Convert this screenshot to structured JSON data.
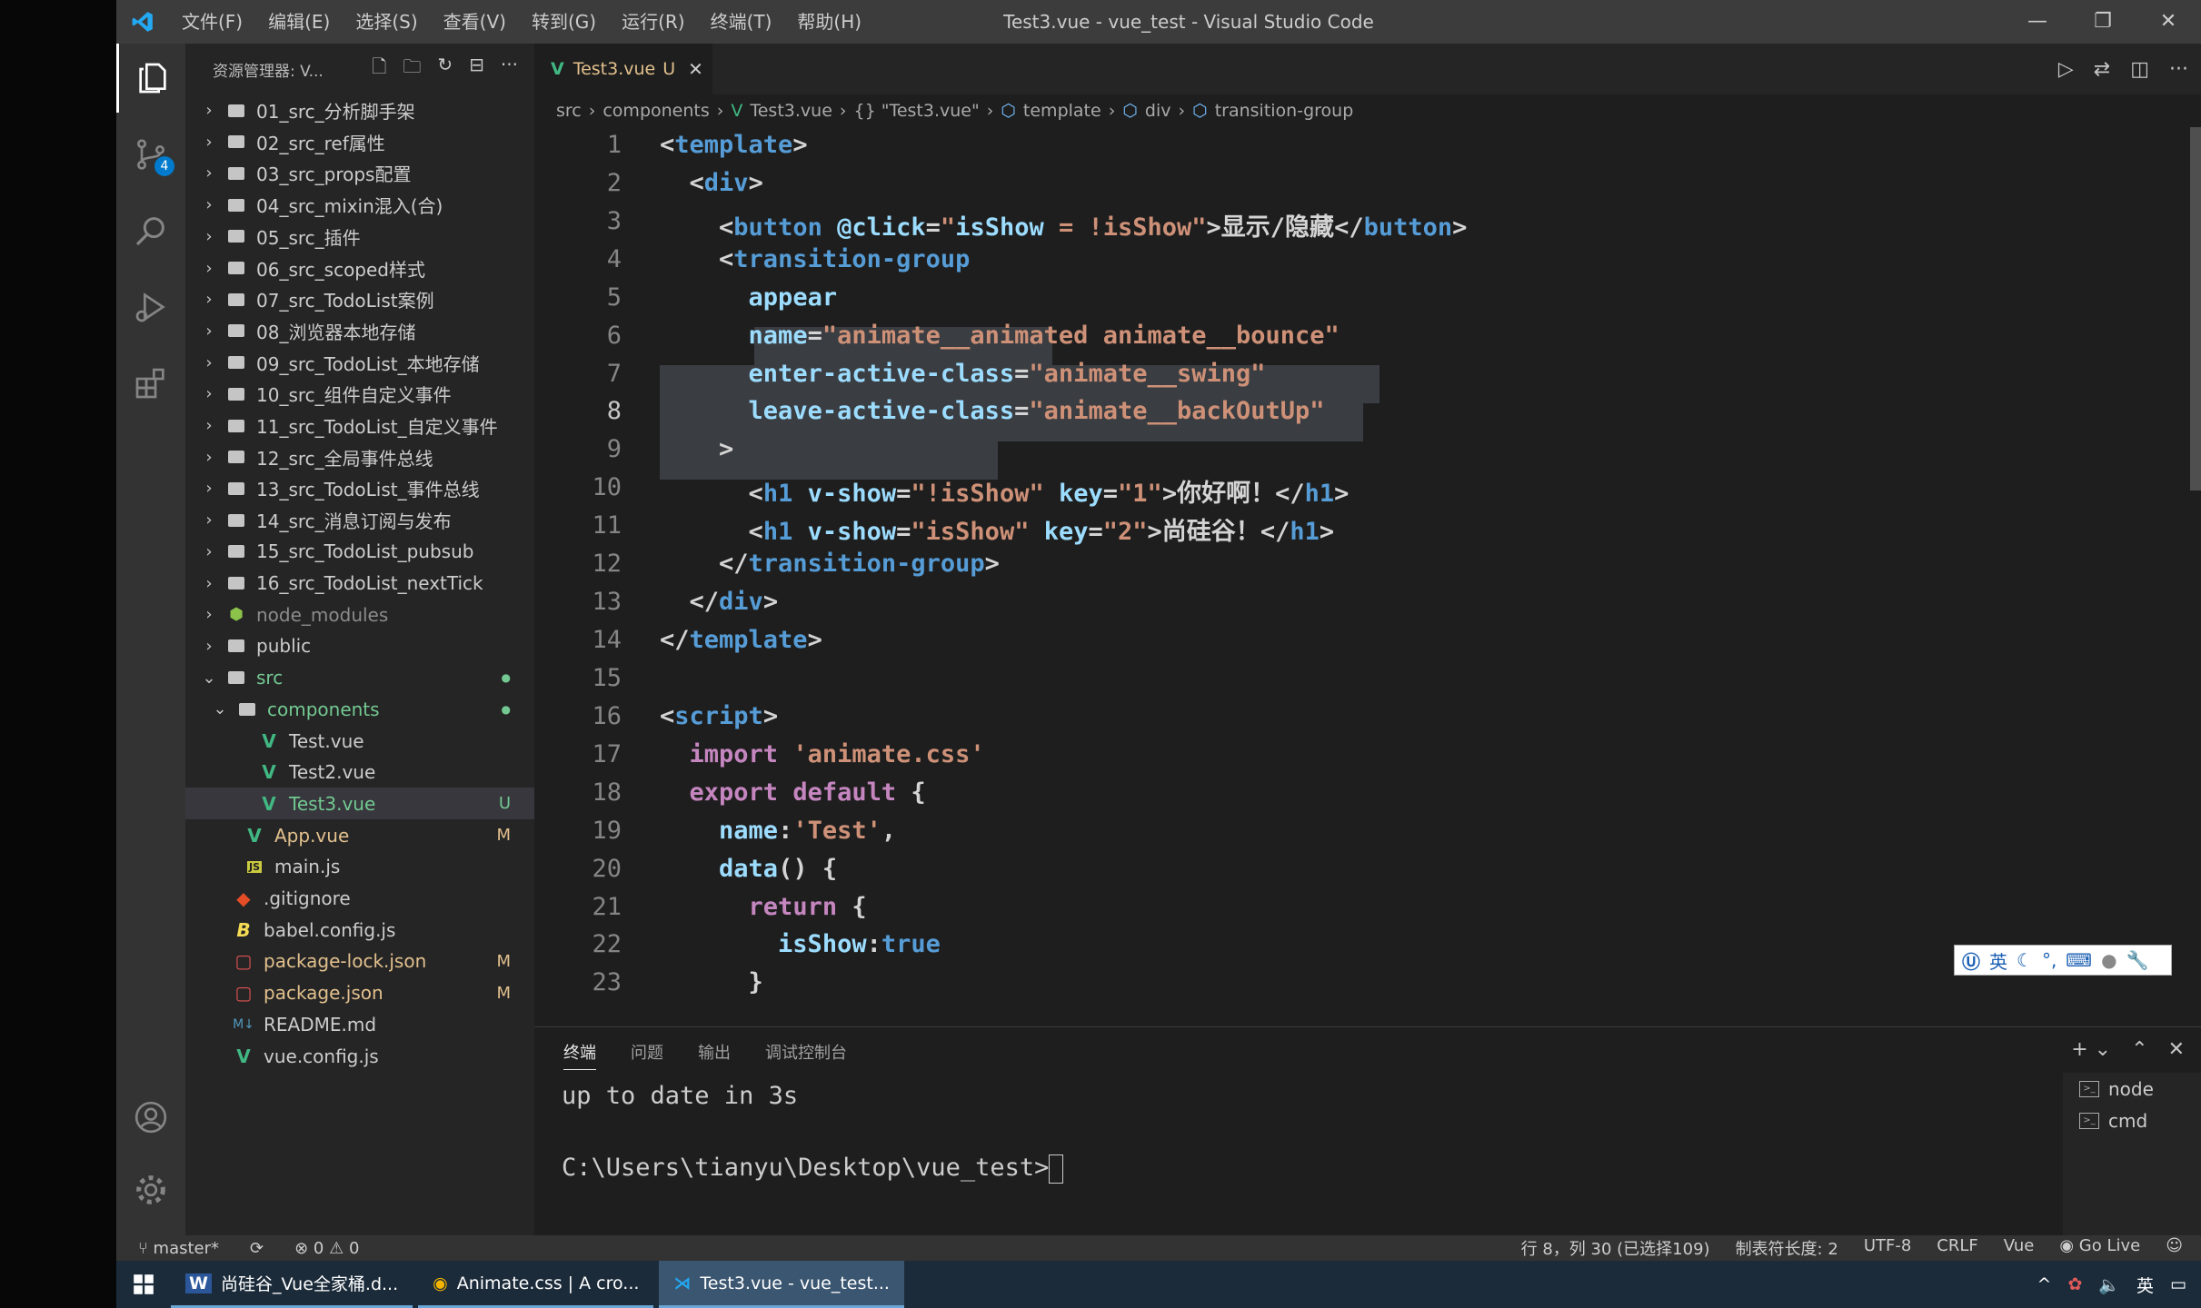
{
  "window": {
    "title": "Test3.vue - vue_test - Visual Studio Code",
    "menu": [
      "文件(F)",
      "编辑(E)",
      "选择(S)",
      "查看(V)",
      "转到(G)",
      "运行(R)",
      "终端(T)",
      "帮助(H)"
    ],
    "controls": {
      "minimize": "—",
      "restore": "❐",
      "close": "✕"
    }
  },
  "activity": {
    "scm_badge": "4"
  },
  "sidebar": {
    "title": "资源管理器: V...",
    "items": [
      {
        "label": "01_src_分析脚手架",
        "kind": "folder"
      },
      {
        "label": "02_src_ref属性",
        "kind": "folder"
      },
      {
        "label": "03_src_props配置",
        "kind": "folder"
      },
      {
        "label": "04_src_mixin混入(合)",
        "kind": "folder"
      },
      {
        "label": "05_src_插件",
        "kind": "folder"
      },
      {
        "label": "06_src_scoped样式",
        "kind": "folder"
      },
      {
        "label": "07_src_TodoList案例",
        "kind": "folder"
      },
      {
        "label": "08_浏览器本地存储",
        "kind": "folder"
      },
      {
        "label": "09_src_TodoList_本地存储",
        "kind": "folder"
      },
      {
        "label": "10_src_组件自定义事件",
        "kind": "folder"
      },
      {
        "label": "11_src_TodoList_自定义事件",
        "kind": "folder"
      },
      {
        "label": "12_src_全局事件总线",
        "kind": "folder"
      },
      {
        "label": "13_src_TodoList_事件总线",
        "kind": "folder"
      },
      {
        "label": "14_src_消息订阅与发布",
        "kind": "folder"
      },
      {
        "label": "15_src_TodoList_pubsub",
        "kind": "folder"
      },
      {
        "label": "16_src_TodoList_nextTick",
        "kind": "folder"
      },
      {
        "label": "node_modules",
        "kind": "node"
      },
      {
        "label": "public",
        "kind": "folder"
      },
      {
        "label": "src",
        "kind": "folder-open",
        "deco": "●"
      },
      {
        "label": "components",
        "kind": "folder-open",
        "deco": "●"
      },
      {
        "label": "Test.vue",
        "kind": "vue"
      },
      {
        "label": "Test2.vue",
        "kind": "vue"
      },
      {
        "label": "Test3.vue",
        "kind": "vue",
        "deco": "U"
      },
      {
        "label": "App.vue",
        "kind": "vue",
        "deco": "M"
      },
      {
        "label": "main.js",
        "kind": "js"
      },
      {
        "label": ".gitignore",
        "kind": "git"
      },
      {
        "label": "babel.config.js",
        "kind": "babel"
      },
      {
        "label": "package-lock.json",
        "kind": "json",
        "deco": "M"
      },
      {
        "label": "package.json",
        "kind": "json",
        "deco": "M"
      },
      {
        "label": "README.md",
        "kind": "md"
      },
      {
        "label": "vue.config.js",
        "kind": "vue"
      }
    ]
  },
  "tab": {
    "label": "Test3.vue",
    "status": "U",
    "close": "✕"
  },
  "breadcrumb": [
    "src",
    "components",
    "Test3.vue",
    "{} \"Test3.vue\"",
    "template",
    "div",
    "transition-group"
  ],
  "editor": {
    "line_numbers": [
      "1",
      "2",
      "3",
      "4",
      "5",
      "6",
      "7",
      "8",
      "9",
      "10",
      "11",
      "12",
      "13",
      "14",
      "15",
      "16",
      "17",
      "18",
      "19",
      "20",
      "21",
      "22",
      "23"
    ],
    "lines": [
      "<template>",
      "  <div>",
      "    <button @click=\"isShow = !isShow\">显示/隐藏</button>",
      "    <transition-group",
      "      appear",
      "      name=\"animate__animated animate__bounce\"",
      "      enter-active-class=\"animate__swing\"",
      "      leave-active-class=\"animate__backOutUp\"",
      "    >",
      "      <h1 v-show=\"!isShow\" key=\"1\">你好啊！</h1>",
      "      <h1 v-show=\"isShow\" key=\"2\">尚硅谷！</h1>",
      "    </transition-group>",
      "  </div>",
      "</template>",
      "",
      "<script>",
      "  import 'animate.css'",
      "  export default {",
      "    name:'Test',",
      "    data() {",
      "      return {",
      "        isShow:true",
      "      }"
    ]
  },
  "ime": {
    "label": "英"
  },
  "panel": {
    "tabs": [
      "终端",
      "问题",
      "输出",
      "调试控制台"
    ],
    "terminal_lines": [
      "up to date in 3s",
      "",
      "C:\\Users\\tianyu\\Desktop\\vue_test>"
    ],
    "terminals": [
      "node",
      "cmd"
    ]
  },
  "status": {
    "branch": "master*",
    "sync": "⟳",
    "problems": "⊗ 0 ⚠ 0",
    "position": "行 8，列 30 (已选择109)",
    "tab_size": "制表符长度: 2",
    "encoding": "UTF-8",
    "eol": "CRLF",
    "language": "Vue",
    "golive": "Go Live"
  },
  "taskbar": {
    "items": [
      "尚硅谷_Vue全家桶.d...",
      "Animate.css | A cro...",
      "Test3.vue - vue_test..."
    ],
    "tray_ime": "英"
  },
  "colors": {
    "accent": "#007acc",
    "editor_bg": "#1e1e1e",
    "sidebar_bg": "#252526",
    "tag": "#569cd6",
    "attr": "#9cdcfe",
    "string": "#ce9178",
    "keyword": "#c586c0"
  }
}
